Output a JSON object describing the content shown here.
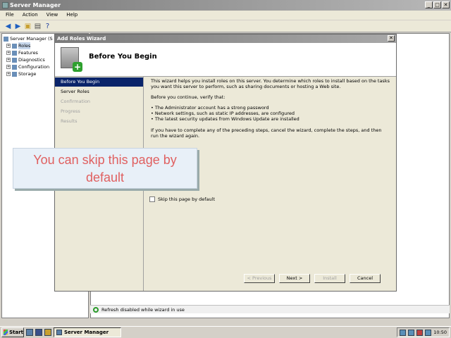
{
  "app": {
    "title": "Server Manager"
  },
  "menubar": [
    "File",
    "Action",
    "View",
    "Help"
  ],
  "tree": {
    "root": "Server Manager (S",
    "items": [
      "Roles",
      "Features",
      "Diagnostics",
      "Configuration",
      "Storage"
    ]
  },
  "statusbar": {
    "text": "Refresh disabled while wizard in use"
  },
  "wizard": {
    "title": "Add Roles Wizard",
    "close": "✕",
    "header_title": "Before You Begin",
    "nav": [
      {
        "label": "Before You Begin",
        "state": "active"
      },
      {
        "label": "Server Roles",
        "state": "normal"
      },
      {
        "label": "Confirmation",
        "state": "disabled"
      },
      {
        "label": "Progress",
        "state": "disabled"
      },
      {
        "label": "Results",
        "state": "disabled"
      }
    ],
    "intro": "This wizard helps you install roles on this server. You determine which roles to install based on the tasks you want this server to perform, such as sharing documents or hosting a Web site.",
    "verify_heading": "Before you continue, verify that:",
    "bullets": [
      "The Administrator account has a strong password",
      "Network settings, such as static IP addresses, are configured",
      "The latest security updates from Windows Update are installed"
    ],
    "instructions": "If you have to complete any of the preceding steps, cancel the wizard, complete the steps, and then run the wizard again.",
    "skip_label": "Skip this page by default",
    "buttons": {
      "previous": "< Previous",
      "next": "Next >",
      "install": "Install",
      "cancel": "Cancel"
    }
  },
  "callout": {
    "line1": "You can skip this page by",
    "line2": "default"
  },
  "taskbar": {
    "start": "Start",
    "task": "Server Manager",
    "clock": "10:50"
  }
}
